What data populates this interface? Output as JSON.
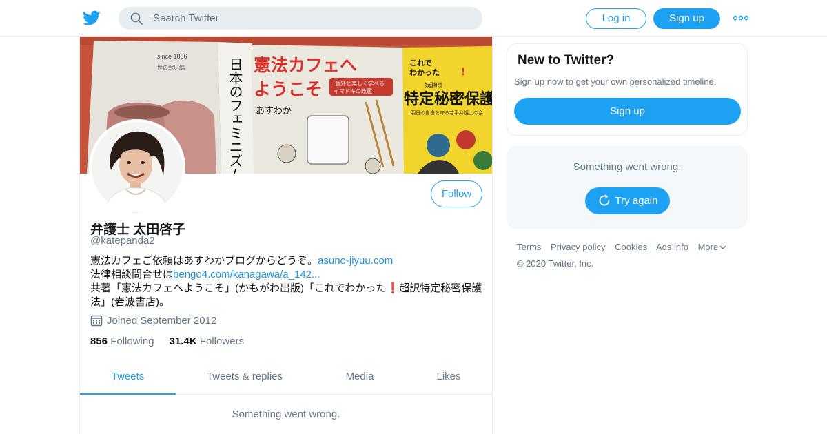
{
  "topbar": {
    "search_placeholder": "Search Twitter",
    "login_label": "Log in",
    "signup_label": "Sign up",
    "more_icon": "more-dots-icon"
  },
  "colors": {
    "accent": "#1da1f2",
    "link": "#1b95e0",
    "muted": "#657786",
    "text": "#14171a",
    "border": "#e6ecf0",
    "panel": "#f5f8fa"
  },
  "profile": {
    "display_name": "弁護士 太田啓子",
    "handle": "@katepanda2",
    "follow_label": "Follow",
    "bio": {
      "line1_text": "憲法カフェご依頼はあすわかブログからどうぞ。",
      "line1_link": "asuno-jiyuu.com",
      "line2_text": "法律相談問合せは",
      "line2_link": "bengo4.com/kanagawa/a_142...",
      "line3_before": "共著「憲法カフェへようこそ」(かもがわ出版)「これでわかった",
      "line3_emoji": "❗",
      "line3_after": "超訳特定秘密保護法」(岩波書店)。"
    },
    "joined": "Joined September 2012",
    "following_count": "856",
    "following_label": "Following",
    "followers_count": "31.4K",
    "followers_label": "Followers"
  },
  "banner": {
    "book1_since": "since 1886",
    "book1_sub": "世の戦い編",
    "book2_spine": "日本のフェミニズム",
    "book3_title_a": "憲法カフェへ",
    "book3_title_b": "ようこそ",
    "book3_tag_a": "意外と楽しく学べる",
    "book3_tag_b": "イマドキの改憲",
    "book3_author": "あすわか",
    "book4_top_a": "これで",
    "book4_top_b": "わかった",
    "book4_mark": "!",
    "book4_bracket": "《超訳》",
    "book4_title": "特定秘密保護",
    "book4_sub": "明日の自由を守る若手弁護士の会"
  },
  "tabs": [
    {
      "label": "Tweets",
      "active": true
    },
    {
      "label": "Tweets & replies",
      "active": false
    },
    {
      "label": "Media",
      "active": false
    },
    {
      "label": "Likes",
      "active": false
    }
  ],
  "feed": {
    "error_message": "Something went wrong."
  },
  "sidebar": {
    "new_title": "New to Twitter?",
    "new_subtitle": "Sign up now to get your own personalized timeline!",
    "signup_label": "Sign up",
    "error_message": "Something went wrong.",
    "try_again_label": "Try again"
  },
  "footer": {
    "links": [
      "Terms",
      "Privacy policy",
      "Cookies",
      "Ads info",
      "More"
    ],
    "copyright": "© 2020 Twitter, Inc."
  }
}
